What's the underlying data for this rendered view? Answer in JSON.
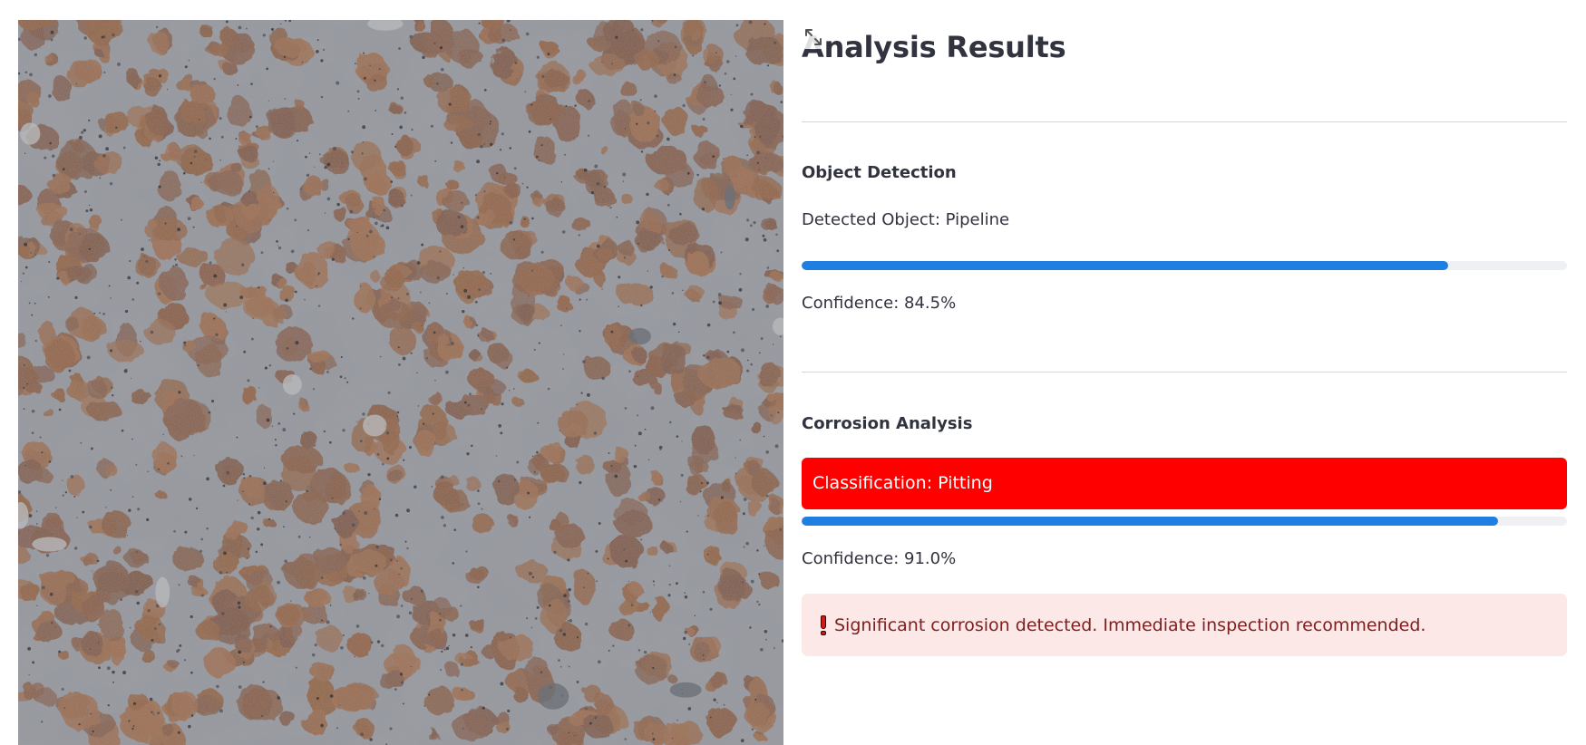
{
  "image": {
    "alt": "corroded pipeline surface",
    "fullscreen_icon": "expand-arrows-icon"
  },
  "results": {
    "title": "Analysis Results"
  },
  "object_detection": {
    "heading": "Object Detection",
    "detected_label": "Detected Object: Pipeline",
    "confidence_value": 0.845,
    "confidence_text": "Confidence: 84.5%"
  },
  "corrosion_analysis": {
    "heading": "Corrosion Analysis",
    "classification_text": "Classification: Pitting",
    "banner_color": "#ff0000",
    "confidence_value": 0.91,
    "confidence_text": "Confidence: 91.0%"
  },
  "alert": {
    "icon": "exclamation-icon",
    "message": "Significant corrosion detected. Immediate inspection recommended.",
    "background_color": "#fde8e8",
    "text_color": "#7d2020"
  },
  "colors": {
    "progress_fill": "#1f7fe0",
    "progress_track": "#eef0f4"
  }
}
